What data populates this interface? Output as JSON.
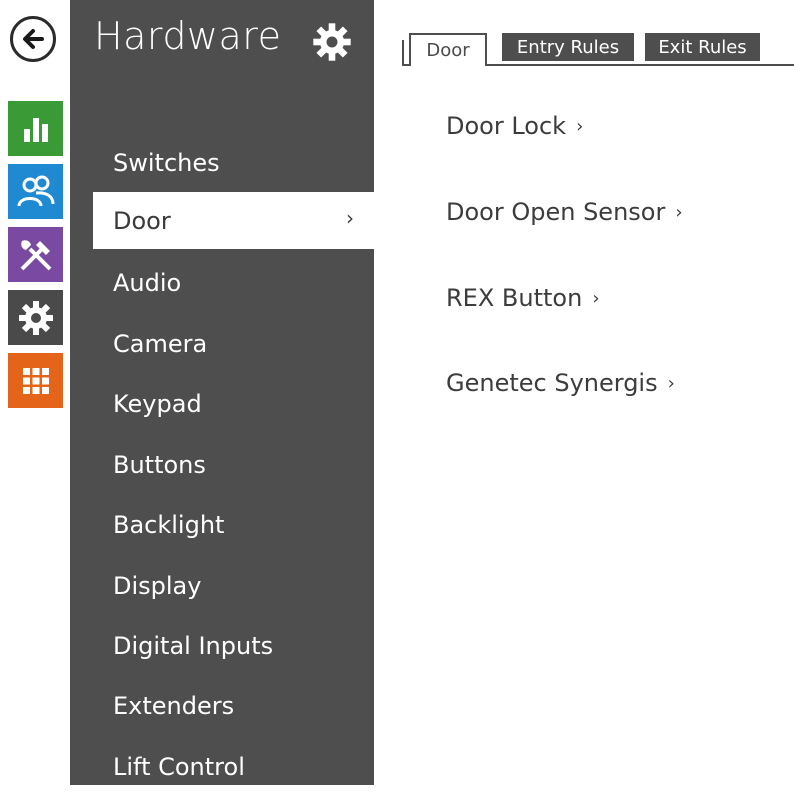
{
  "menu": {
    "title": "Hardware",
    "items": [
      {
        "label": "Switches"
      },
      {
        "label": "Door",
        "chevron": "›"
      },
      {
        "label": "Audio"
      },
      {
        "label": "Camera"
      },
      {
        "label": "Keypad"
      },
      {
        "label": "Buttons"
      },
      {
        "label": "Backlight"
      },
      {
        "label": "Display"
      },
      {
        "label": "Digital Inputs"
      },
      {
        "label": "Extenders"
      },
      {
        "label": "Lift Control"
      }
    ]
  },
  "tabs": [
    {
      "label": "Door"
    },
    {
      "label": "Entry Rules"
    },
    {
      "label": "Exit Rules"
    }
  ],
  "content": {
    "links": [
      {
        "label": "Door Lock",
        "arrow": "›"
      },
      {
        "label": "Door Open Sensor",
        "arrow": "›"
      },
      {
        "label": "REX Button",
        "arrow": "›"
      },
      {
        "label": "Genetec Synergis",
        "arrow": "›"
      }
    ]
  },
  "rail": {
    "icons": [
      "back-arrow-icon",
      "bar-chart-icon",
      "users-icon",
      "tools-icon",
      "gear-icon",
      "grid-icon"
    ]
  },
  "colors": {
    "menu_bg": "#4e4e4e",
    "status_green": "#3a9a35",
    "directory_blue": "#1f8ad1",
    "hardware_purple": "#7a4aa2",
    "services_gray": "#4a4a4a",
    "system_orange": "#e4641a"
  }
}
